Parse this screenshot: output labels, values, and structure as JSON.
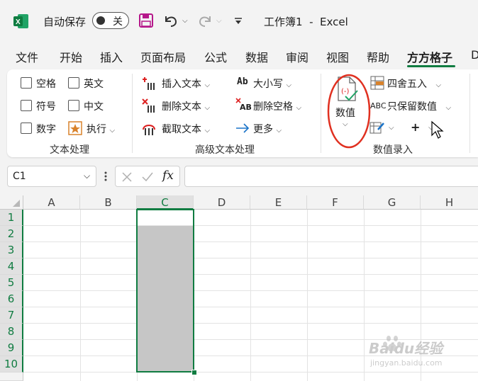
{
  "titlebar": {
    "autosave_label": "自动保存",
    "autosave_state": "关",
    "document_title": "工作簿1  -  Excel"
  },
  "menu": {
    "tabs": [
      "文件",
      "开始",
      "插入",
      "页面布局",
      "公式",
      "数据",
      "审阅",
      "视图",
      "帮助",
      "方方格子",
      "D"
    ],
    "active_tab": "方方格子"
  },
  "ribbon": {
    "text_processing": {
      "checkboxes": [
        "空格",
        "英文",
        "符号",
        "中文",
        "数字"
      ],
      "execute_label": "执行",
      "group_label": "文本处理"
    },
    "advanced_text": {
      "insert_text": "插入文本",
      "delete_text": "删除文本",
      "extract_text": "截取文本",
      "case_label": "大小写",
      "case_icon_text": "Ab",
      "delete_space": "删除空格",
      "delete_space_icon_text": "AB",
      "more": "更多",
      "group_label": "高级文本处理"
    },
    "numeric_entry": {
      "value_button": "数值",
      "round_label": "四舍五入",
      "keep_values": "只保留数值",
      "keep_values_icon_text": "ABC",
      "plus_symbol": "+",
      "group_label": "数值录入"
    }
  },
  "formula_bar": {
    "name_box": "C1",
    "fx_label": "fx",
    "formula_value": ""
  },
  "grid": {
    "columns": [
      "A",
      "B",
      "C",
      "D",
      "E",
      "F",
      "G",
      "H"
    ],
    "rows": [
      "1",
      "2",
      "3",
      "4",
      "5",
      "6",
      "7",
      "8",
      "9",
      "10"
    ],
    "selected_range": "C1:C10"
  },
  "watermark": {
    "brand": "Baidu经验",
    "url": "jingyan.baidu.com"
  },
  "colors": {
    "excel_green": "#107c41",
    "save_icon": "#b5178a",
    "highlight_circle": "#e03020",
    "selection_fill": "#c6c6c6"
  }
}
